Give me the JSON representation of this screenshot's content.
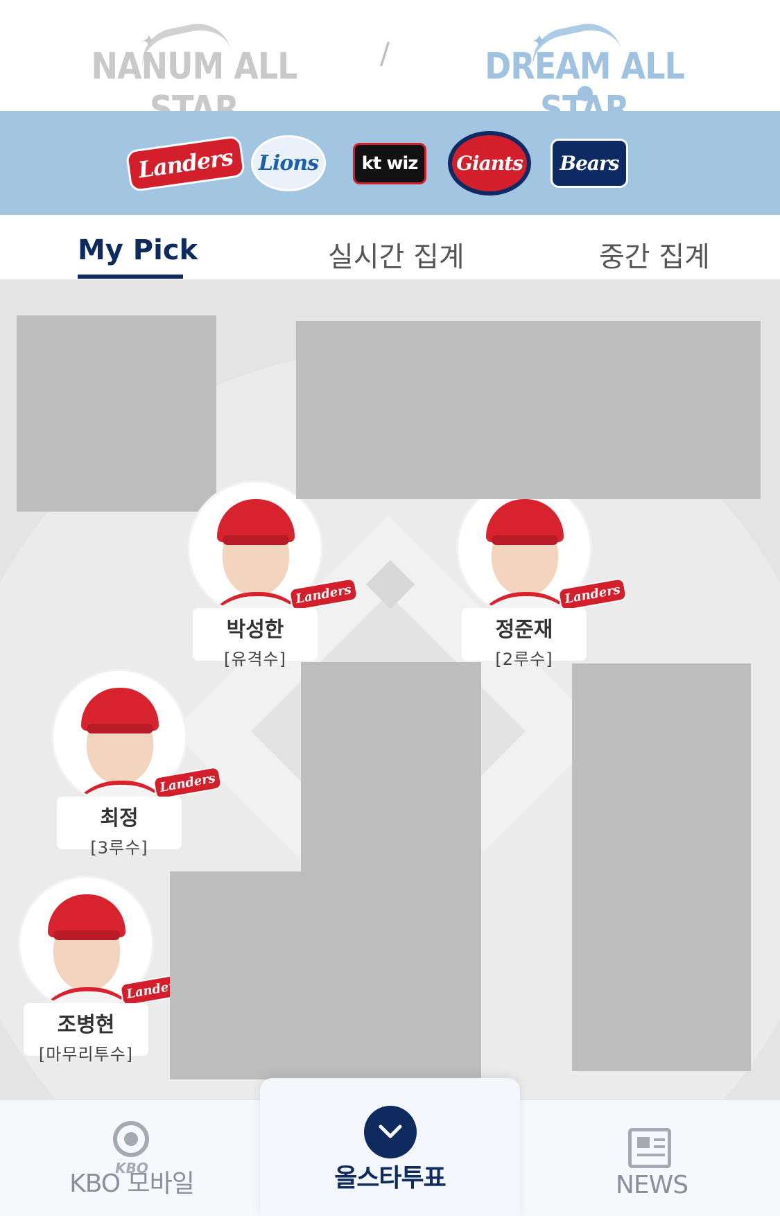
{
  "leagues": {
    "nanum": "NANUM ALL STAR",
    "divider": "/",
    "dream": "DREAM ALL STAR"
  },
  "teams": [
    {
      "name": "Landers",
      "icon": "landers-logo"
    },
    {
      "name": "Lions",
      "icon": "lions-logo"
    },
    {
      "name": "kt wiz",
      "icon": "ktwiz-logo"
    },
    {
      "name": "Giants",
      "icon": "giants-logo"
    },
    {
      "name": "Bears",
      "icon": "bears-logo"
    }
  ],
  "tabs": {
    "my_pick": "My Pick",
    "realtime": "실시간 집계",
    "interim": "중간 집계"
  },
  "players": [
    {
      "name": "박성한",
      "position": "[유격수]",
      "team_badge": "Landers"
    },
    {
      "name": "정준재",
      "position": "[2루수]",
      "team_badge": "Landers"
    },
    {
      "name": "최정",
      "position": "[3루수]",
      "team_badge": "Landers"
    },
    {
      "name": "조병현",
      "position": "[마무리투수]",
      "team_badge": "Landers"
    }
  ],
  "bottom_nav": {
    "kbo": "KBO 모바일",
    "kbo_mini": "KBO",
    "vote": "올스타투표",
    "news": "NEWS"
  },
  "colors": {
    "primary": "#0e2a5e",
    "team_strip": "#a2c5e2",
    "dream_accent": "#9fc2e1",
    "landers_red": "#d21f2b"
  }
}
